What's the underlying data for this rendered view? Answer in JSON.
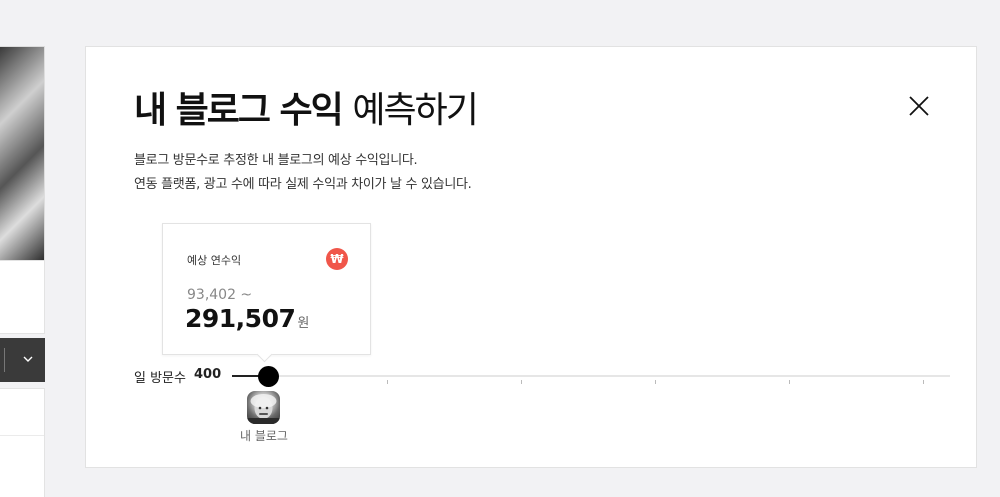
{
  "modal": {
    "title_bold": "내 블로그 수익",
    "title_light": "예측하기",
    "close_icon": "close-icon",
    "description": [
      "블로그 방문수로 추정한 내 블로그의 예상 수익입니다.",
      "연동 플랫폼, 광고 수에 따라 실제 수익과 차이가 날 수 있습니다."
    ]
  },
  "estimate": {
    "label": "예상 연수익",
    "currency_icon": "won-icon",
    "currency_symbol": "₩",
    "min_value": "93,402 ~",
    "max_value": "291,507",
    "unit": "원"
  },
  "slider": {
    "label": "일 방문수",
    "value": "400",
    "position_fraction": 0.05,
    "tick_count": 5
  },
  "blog": {
    "name": "내 블로그",
    "avatar_icon": "avatar-photo"
  },
  "colors": {
    "accent_won": "#f0564a",
    "slider_thumb": "#000000",
    "background": "#f2f2f4"
  }
}
